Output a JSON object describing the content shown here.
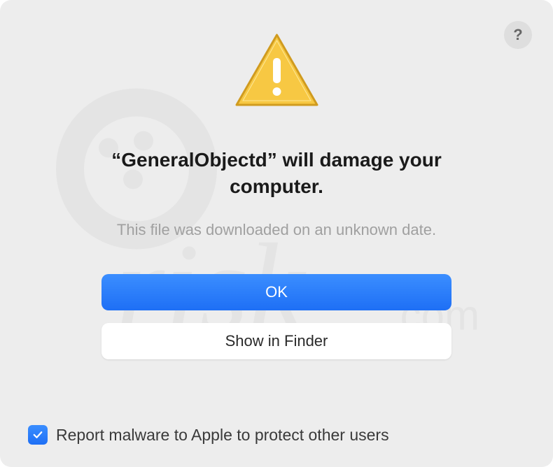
{
  "dialog": {
    "title": "“GeneralObjectd” will damage your computer.",
    "subtitle": "This file was downloaded on an unknown date.",
    "help_label": "?",
    "buttons": {
      "primary": "OK",
      "secondary": "Show in Finder"
    },
    "checkbox": {
      "checked": true,
      "label": "Report malware to Apple to protect other users"
    }
  },
  "colors": {
    "primary_button": "#2a7cf7",
    "background": "#ededed"
  }
}
